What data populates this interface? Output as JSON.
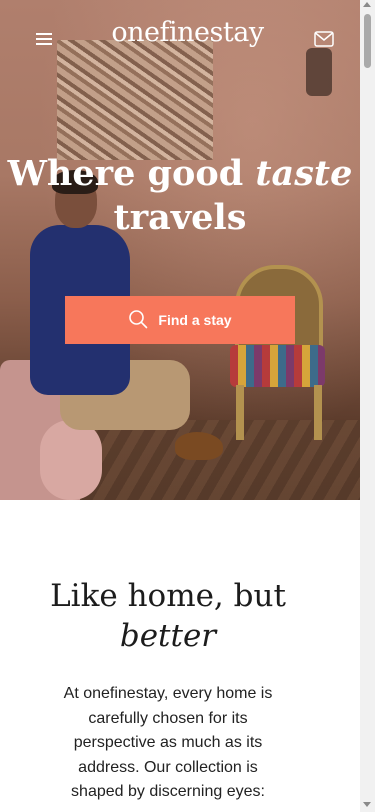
{
  "header": {
    "logo_text": "onefinestay",
    "menu_icon": "hamburger-menu-icon",
    "mail_icon": "mail-icon"
  },
  "hero": {
    "title_line1_start": "Where good ",
    "title_line1_em": "taste",
    "title_line2": "travels",
    "cta_label": "Find a stay",
    "cta_icon": "search-icon",
    "cta_color": "#f7775b"
  },
  "intro": {
    "title_line1": "Like home, but",
    "title_line2_em": "better",
    "body": "At onefinestay, every home is carefully chosen for its perspective as much as its address. Our collection is shaped by discerning eyes:"
  },
  "colors": {
    "accent": "#f7775b",
    "text_dark": "#1c1c1c"
  }
}
